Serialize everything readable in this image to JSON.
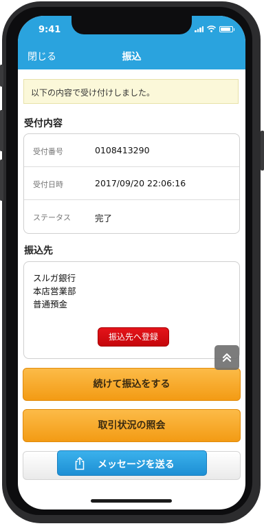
{
  "status_bar": {
    "time": "9:41"
  },
  "nav": {
    "close_label": "閉じる",
    "title": "振込"
  },
  "notice": {
    "message": "以下の内容で受け付けしました。"
  },
  "receipt": {
    "section_title": "受付内容",
    "rows": [
      {
        "label": "受付番号",
        "value": "0108413290"
      },
      {
        "label": "受付日時",
        "value": "2017/09/20 22:06:16"
      },
      {
        "label": "ステータス",
        "value": "完了"
      }
    ]
  },
  "payee": {
    "section_title": "振込先",
    "lines": [
      "スルガ銀行",
      "本店営業部",
      "普通預金"
    ],
    "register_label": "振込先へ登録"
  },
  "actions": {
    "continue_label": "続けて振込をする",
    "history_label": "取引状況の照会",
    "share_label": "メッセージを送る"
  },
  "icons": {
    "scroll_top": "chevrons-up-icon",
    "share": "share-icon",
    "signal": "signal-icon",
    "wifi": "wifi-icon",
    "battery": "battery-icon"
  },
  "colors": {
    "header": "#2aa3de",
    "notice_bg": "#fbf8d9",
    "register_button": "#d90d12",
    "orange_button": "#f6a52a",
    "share_button": "#2aa0e2"
  }
}
